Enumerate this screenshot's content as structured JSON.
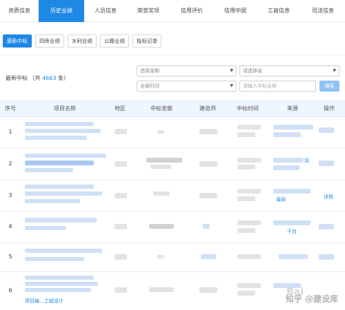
{
  "top_tabs": [
    "资质信息",
    "历史业绩",
    "人员信息",
    "荣誉奖项",
    "信用评价",
    "信用中国",
    "工商信息",
    "司法信息"
  ],
  "sub_tabs": [
    "最新中标",
    "四库业绩",
    "水利业绩",
    "公路业绩",
    "投标记录"
  ],
  "summary": {
    "label": "最新中标",
    "count_prefix": "（共",
    "count": "4663",
    "count_suffix": "条）"
  },
  "filters": {
    "amount_select": "选择金额",
    "builder_select": "请选择省",
    "time_select": "全部时间",
    "project_placeholder": "请输入中标名称",
    "search_button": "搜索"
  },
  "table": {
    "headers": [
      "序号",
      "项目名称",
      "地区",
      "中标金额",
      "建造师",
      "中标时间",
      "来源",
      "操作"
    ],
    "rows": [
      {
        "num": "1"
      },
      {
        "num": "2",
        "source_tail": "运"
      },
      {
        "num": "3",
        "source_tail": "易网",
        "action": "详情"
      },
      {
        "num": "4",
        "source_tail": "干台"
      },
      {
        "num": "5"
      },
      {
        "num": "6",
        "name_tail": "项目编…工程设计"
      }
    ]
  },
  "watermark": {
    "text": "知乎 @建设库",
    "baidu": "Bai"
  }
}
